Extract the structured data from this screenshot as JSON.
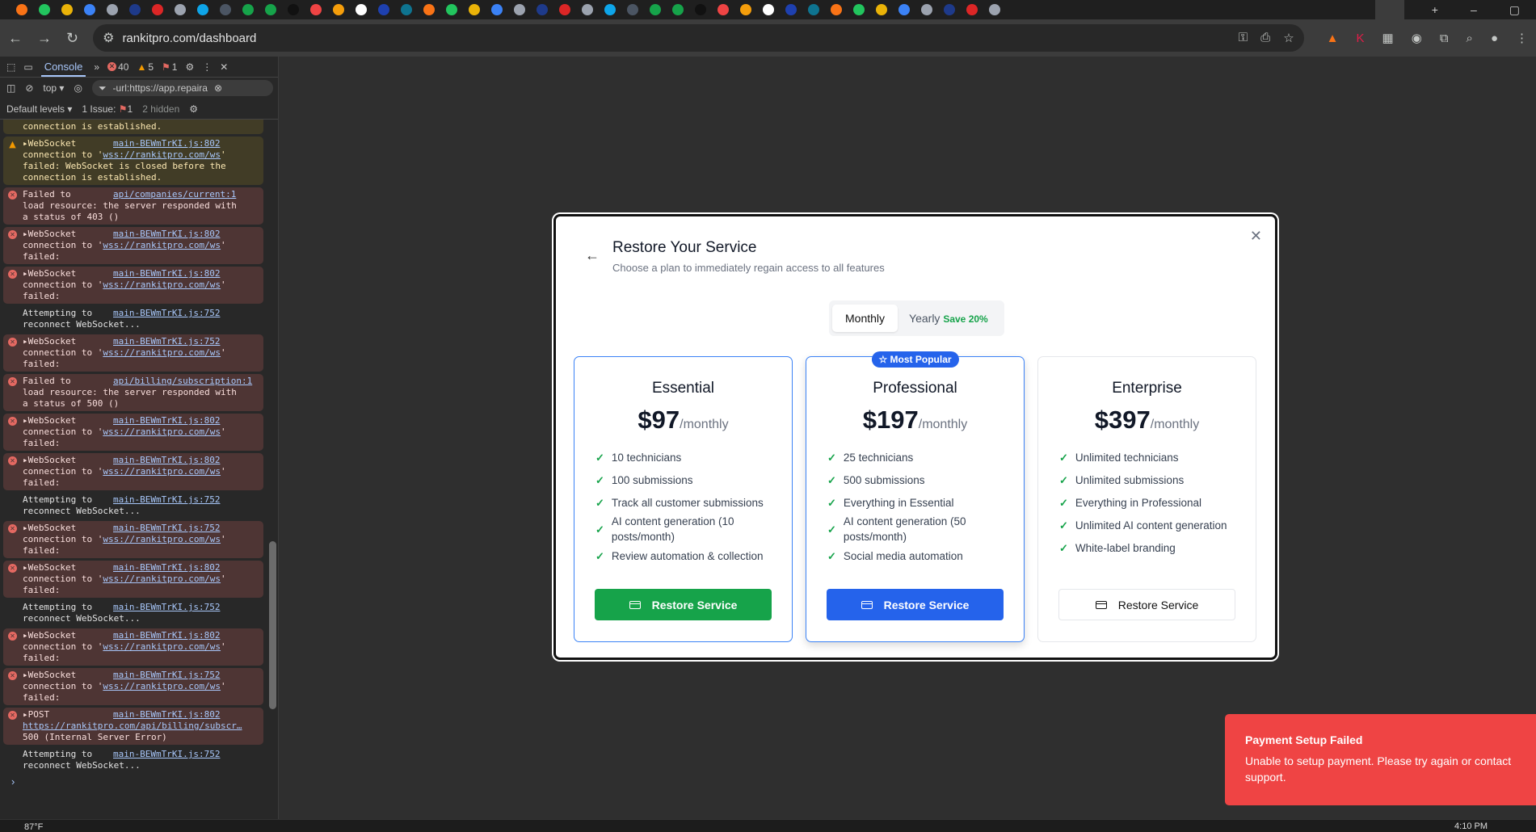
{
  "browser": {
    "url": "rankitpro.com/dashboard"
  },
  "devtools": {
    "tab": "Console",
    "errors": "40",
    "warnings": "5",
    "issues_badge": "1",
    "context": "top",
    "filter": "-url:https://app.repaira",
    "levels": "Default levels",
    "issues_label": "1 Issue:",
    "issues_count": "1",
    "hidden": "2 hidden",
    "entries": [
      {
        "type": "warn",
        "first": true,
        "lines": [
          [
            {
              "t": "connection is established."
            }
          ]
        ]
      },
      {
        "type": "warn",
        "head": "WebSocket",
        "src": "main-BEWmTrKI.js:802",
        "lines": [
          [
            {
              "t": "connection to '"
            },
            {
              "t": "wss://rankitpro.com/ws",
              "link": true
            },
            {
              "t": "'"
            }
          ],
          [
            {
              "t": "failed: WebSocket is closed before the"
            }
          ],
          [
            {
              "t": "connection is established."
            }
          ]
        ]
      },
      {
        "type": "error",
        "plain": "Failed to",
        "src": "api/companies/current:1",
        "lines": [
          [
            {
              "t": "load resource: the server responded with"
            }
          ],
          [
            {
              "t": "a status of 403 ()"
            }
          ]
        ]
      },
      {
        "type": "error",
        "head": "WebSocket",
        "src": "main-BEWmTrKI.js:802",
        "lines": [
          [
            {
              "t": "connection to '"
            },
            {
              "t": "wss://rankitpro.com/ws",
              "link": true
            },
            {
              "t": "'"
            }
          ],
          [
            {
              "t": "failed:"
            }
          ]
        ]
      },
      {
        "type": "error",
        "head": "WebSocket",
        "src": "main-BEWmTrKI.js:802",
        "lines": [
          [
            {
              "t": "connection to '"
            },
            {
              "t": "wss://rankitpro.com/ws",
              "link": true
            },
            {
              "t": "'"
            }
          ],
          [
            {
              "t": "failed:"
            }
          ]
        ]
      },
      {
        "type": "info",
        "plain": "Attempting to",
        "src": "main-BEWmTrKI.js:752",
        "lines": [
          [
            {
              "t": "reconnect WebSocket..."
            }
          ]
        ]
      },
      {
        "type": "error",
        "head": "WebSocket",
        "src": "main-BEWmTrKI.js:752",
        "lines": [
          [
            {
              "t": "connection to '"
            },
            {
              "t": "wss://rankitpro.com/ws",
              "link": true
            },
            {
              "t": "'"
            }
          ],
          [
            {
              "t": "failed:"
            }
          ]
        ]
      },
      {
        "type": "error",
        "plain": "Failed to",
        "src": "api/billing/subscription:1",
        "lines": [
          [
            {
              "t": "load resource: the server responded with"
            }
          ],
          [
            {
              "t": "a status of 500 ()"
            }
          ]
        ]
      },
      {
        "type": "error",
        "head": "WebSocket",
        "src": "main-BEWmTrKI.js:802",
        "lines": [
          [
            {
              "t": "connection to '"
            },
            {
              "t": "wss://rankitpro.com/ws",
              "link": true
            },
            {
              "t": "'"
            }
          ],
          [
            {
              "t": "failed:"
            }
          ]
        ]
      },
      {
        "type": "error",
        "head": "WebSocket",
        "src": "main-BEWmTrKI.js:802",
        "lines": [
          [
            {
              "t": "connection to '"
            },
            {
              "t": "wss://rankitpro.com/ws",
              "link": true
            },
            {
              "t": "'"
            }
          ],
          [
            {
              "t": "failed:"
            }
          ]
        ]
      },
      {
        "type": "info",
        "plain": "Attempting to",
        "src": "main-BEWmTrKI.js:752",
        "lines": [
          [
            {
              "t": "reconnect WebSocket..."
            }
          ]
        ]
      },
      {
        "type": "error",
        "head": "WebSocket",
        "src": "main-BEWmTrKI.js:752",
        "lines": [
          [
            {
              "t": "connection to '"
            },
            {
              "t": "wss://rankitpro.com/ws",
              "link": true
            },
            {
              "t": "'"
            }
          ],
          [
            {
              "t": "failed:"
            }
          ]
        ]
      },
      {
        "type": "error",
        "head": "WebSocket",
        "src": "main-BEWmTrKI.js:802",
        "lines": [
          [
            {
              "t": "connection to '"
            },
            {
              "t": "wss://rankitpro.com/ws",
              "link": true
            },
            {
              "t": "'"
            }
          ],
          [
            {
              "t": "failed:"
            }
          ]
        ]
      },
      {
        "type": "info",
        "plain": "Attempting to",
        "src": "main-BEWmTrKI.js:752",
        "lines": [
          [
            {
              "t": "reconnect WebSocket..."
            }
          ]
        ]
      },
      {
        "type": "error",
        "head": "WebSocket",
        "src": "main-BEWmTrKI.js:802",
        "lines": [
          [
            {
              "t": "connection to '"
            },
            {
              "t": "wss://rankitpro.com/ws",
              "link": true
            },
            {
              "t": "'"
            }
          ],
          [
            {
              "t": "failed:"
            }
          ]
        ]
      },
      {
        "type": "error",
        "head": "WebSocket",
        "src": "main-BEWmTrKI.js:752",
        "lines": [
          [
            {
              "t": "connection to '"
            },
            {
              "t": "wss://rankitpro.com/ws",
              "link": true
            },
            {
              "t": "'"
            }
          ],
          [
            {
              "t": "failed:"
            }
          ]
        ]
      },
      {
        "type": "error",
        "head": "POST",
        "src": "main-BEWmTrKI.js:802",
        "lines": [
          [
            {
              "t": "https://rankitpro.com/api/billing/subscr…",
              "link": true
            }
          ],
          [
            {
              "t": "500 (Internal Server Error)"
            }
          ]
        ]
      },
      {
        "type": "info",
        "plain": "Attempting to",
        "src": "main-BEWmTrKI.js:752",
        "lines": [
          [
            {
              "t": "reconnect WebSocket..."
            }
          ]
        ]
      }
    ]
  },
  "modal": {
    "title": "Restore Your Service",
    "subtitle": "Choose a plan to immediately regain access to all features",
    "billing": {
      "monthly": "Monthly",
      "yearly": "Yearly",
      "save": "Save 20%"
    },
    "badge": "Most Popular",
    "per": "/monthly",
    "plans": [
      {
        "name": "Essential",
        "price": "$97",
        "features": [
          "10 technicians",
          "100 submissions",
          "Track all customer submissions",
          "AI content generation (10 posts/month)",
          "Review automation & collection"
        ],
        "button": "Restore Service"
      },
      {
        "name": "Professional",
        "price": "$197",
        "features": [
          "25 technicians",
          "500 submissions",
          "Everything in Essential",
          "AI content generation (50 posts/month)",
          "Social media automation"
        ],
        "button": "Restore Service"
      },
      {
        "name": "Enterprise",
        "price": "$397",
        "features": [
          "Unlimited technicians",
          "Unlimited submissions",
          "Everything in Professional",
          "Unlimited AI content generation",
          "White-label branding"
        ],
        "button": "Restore Service"
      }
    ]
  },
  "toast": {
    "title": "Payment Setup Failed",
    "message": "Unable to setup payment. Please try again or contact support.",
    "color": "#ef4444"
  },
  "taskbar": {
    "weather": "87°F",
    "time": "4:10 PM"
  }
}
